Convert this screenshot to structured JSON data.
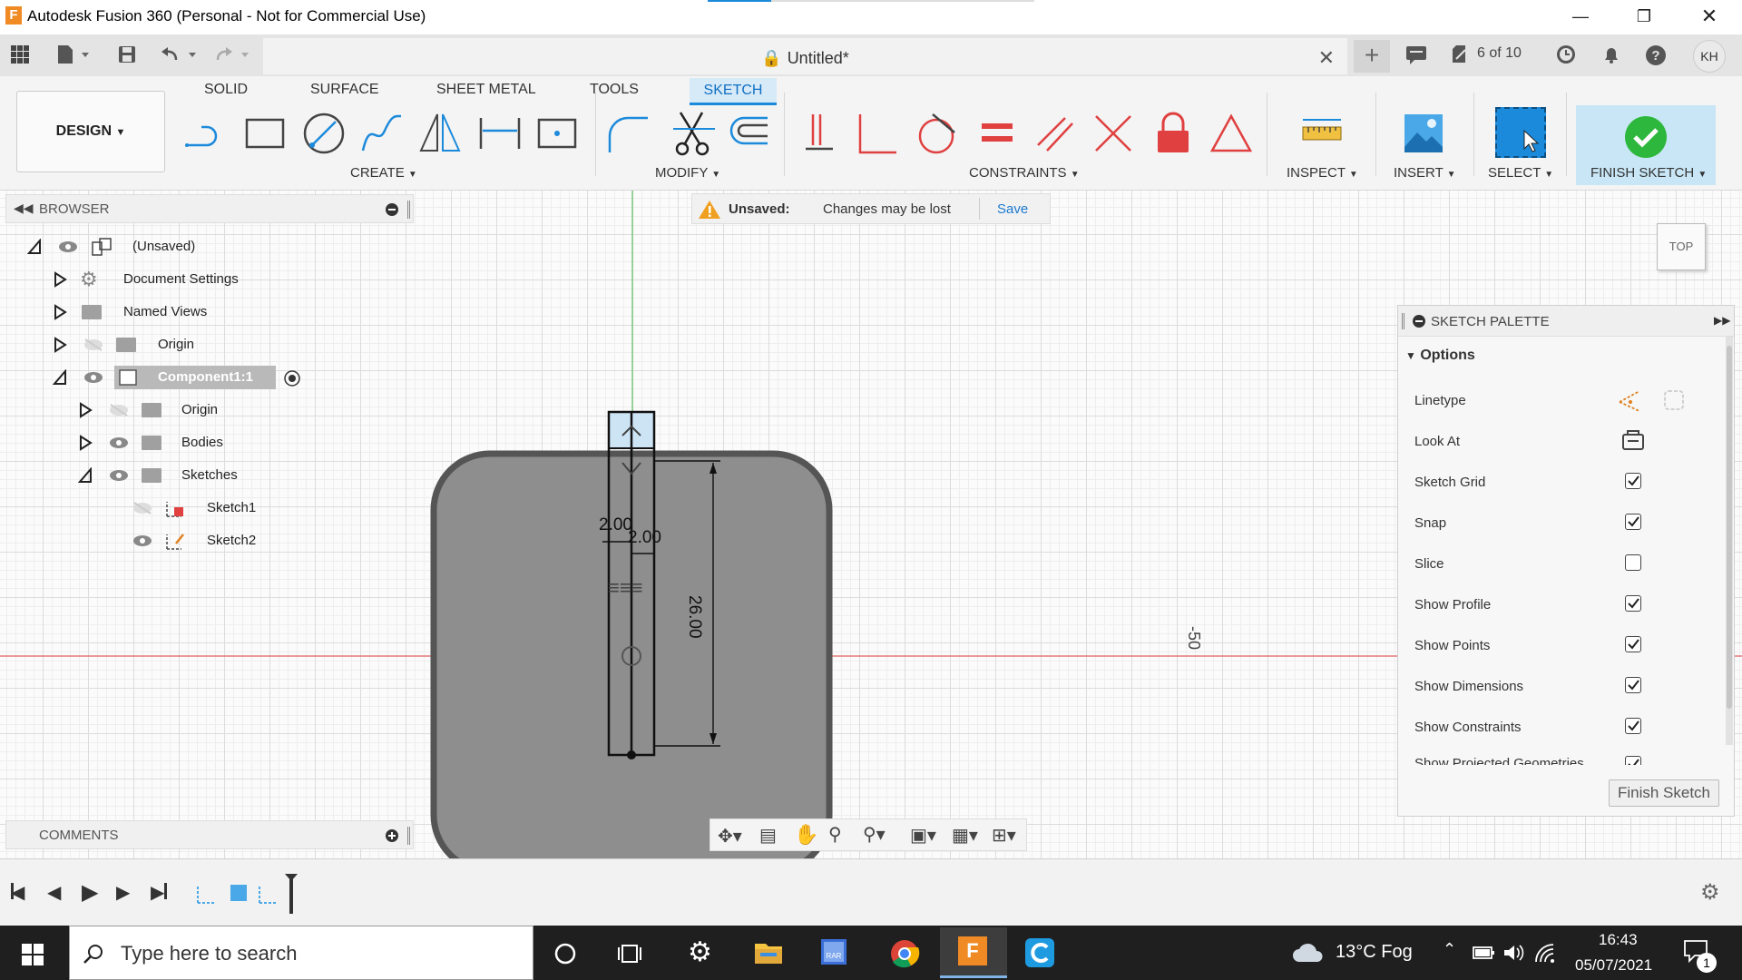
{
  "window": {
    "title": "Autodesk Fusion 360 (Personal - Not for Commercial Use)",
    "logo": "F"
  },
  "appbar": {
    "doc_title": "Untitled*",
    "jobs": "6 of 10",
    "user_initials": "KH"
  },
  "ribbon": {
    "tabs": [
      "SOLID",
      "SURFACE",
      "SHEET METAL",
      "TOOLS",
      "SKETCH"
    ],
    "active_tab": "SKETCH",
    "workspace": "DESIGN",
    "groups": {
      "create": "CREATE",
      "modify": "MODIFY",
      "constraints": "CONSTRAINTS",
      "inspect": "INSPECT",
      "insert": "INSERT",
      "select": "SELECT",
      "finish": "FINISH SKETCH"
    }
  },
  "browser": {
    "title": "BROWSER",
    "items": [
      {
        "label": "(Unsaved)"
      },
      {
        "label": "Document Settings"
      },
      {
        "label": "Named Views"
      },
      {
        "label": "Origin"
      },
      {
        "label": "Component1:1"
      },
      {
        "label": "Origin"
      },
      {
        "label": "Bodies"
      },
      {
        "label": "Sketches"
      },
      {
        "label": "Sketch1"
      },
      {
        "label": "Sketch2"
      }
    ]
  },
  "banner": {
    "status": "Unsaved:",
    "message": "Changes may be lost",
    "save": "Save"
  },
  "canvas": {
    "dim_width_1": "2.00",
    "dim_width_2": "2.00",
    "dim_height": "26.00",
    "axis_label": "-50",
    "viewcube": "TOP"
  },
  "comments": {
    "title": "COMMENTS"
  },
  "palette": {
    "title": "SKETCH PALETTE",
    "section": "Options",
    "linetype": "Linetype",
    "look_at": "Look At",
    "options": [
      {
        "label": "Sketch Grid",
        "checked": true
      },
      {
        "label": "Snap",
        "checked": true
      },
      {
        "label": "Slice",
        "checked": false
      },
      {
        "label": "Show Profile",
        "checked": true
      },
      {
        "label": "Show Points",
        "checked": true
      },
      {
        "label": "Show Dimensions",
        "checked": true
      },
      {
        "label": "Show Constraints",
        "checked": true
      },
      {
        "label": "Show Projected Geometries",
        "checked": true
      }
    ],
    "finish_button": "Finish Sketch"
  },
  "taskbar": {
    "search_placeholder": "Type here to search",
    "weather": "13°C  Fog",
    "time": "16:43",
    "date": "05/07/2021",
    "notifications": "1"
  },
  "colors": {
    "accent": "#1c8adb",
    "finish_green": "#2db83d",
    "constraint_red": "#e04040",
    "body_gray": "#8e8e8e"
  }
}
